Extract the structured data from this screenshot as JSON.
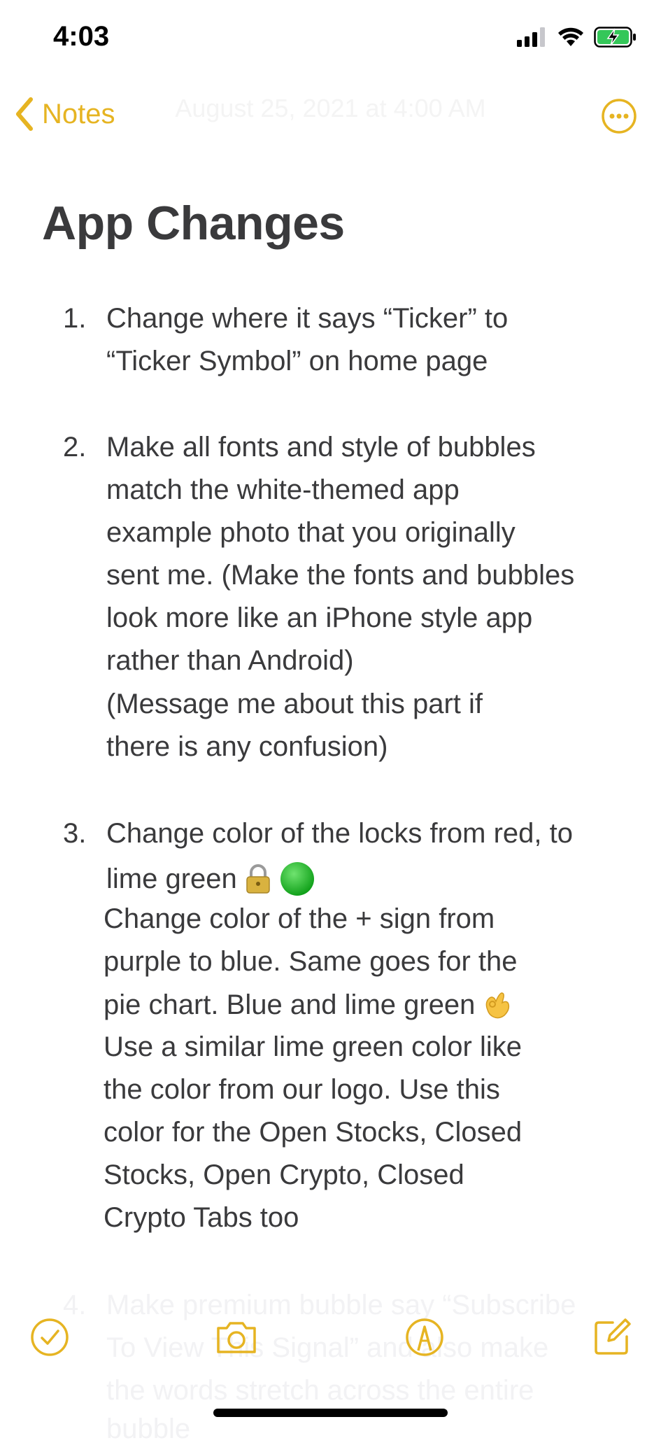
{
  "status": {
    "time": "4:03"
  },
  "nav": {
    "back_label": "Notes",
    "date": "August 25, 2021 at 4:00 AM"
  },
  "note": {
    "title": "App Changes",
    "items": [
      {
        "number": "1.",
        "lines": [
          "Change where it says “Ticker” to",
          "“Ticker Symbol” on home page"
        ]
      },
      {
        "number": "2.",
        "lines": [
          "Make all fonts and style of bubbles",
          "match the white-themed app",
          "example photo that you originally",
          "sent me. (Make the fonts and bubbles",
          "look more like an iPhone style app",
          "rather than Android)",
          "(Message me about this part if",
          " there is any confusion)"
        ]
      },
      {
        "number": "3.",
        "lines": [
          "Change color of the locks from red, to",
          "lime green",
          "Change color of the + sign from",
          "purple to blue. Same goes for the",
          "pie chart. Blue and lime green",
          "Use a similar lime green color like",
          "the color from our logo. Use this",
          "color for the Open Stocks, Closed",
          "Stocks, Open Crypto, Closed",
          "Crypto Tabs too"
        ]
      },
      {
        "number": "4.",
        "lines": [
          "Make premium bubble say “Subscribe",
          "To View This Signal” and also make",
          "the words stretch across the entire",
          "bubble"
        ]
      }
    ]
  },
  "colors": {
    "accent": "#e6b422",
    "text": "#3a3a3c"
  },
  "icons": [
    "signal-icon",
    "wifi-icon",
    "battery-charging-icon",
    "chevron-left-icon",
    "ellipsis-circle-icon",
    "lock-emoji",
    "green-circle-emoji",
    "ok-hand-emoji",
    "checklist-icon",
    "camera-icon",
    "markup-icon",
    "compose-icon"
  ]
}
